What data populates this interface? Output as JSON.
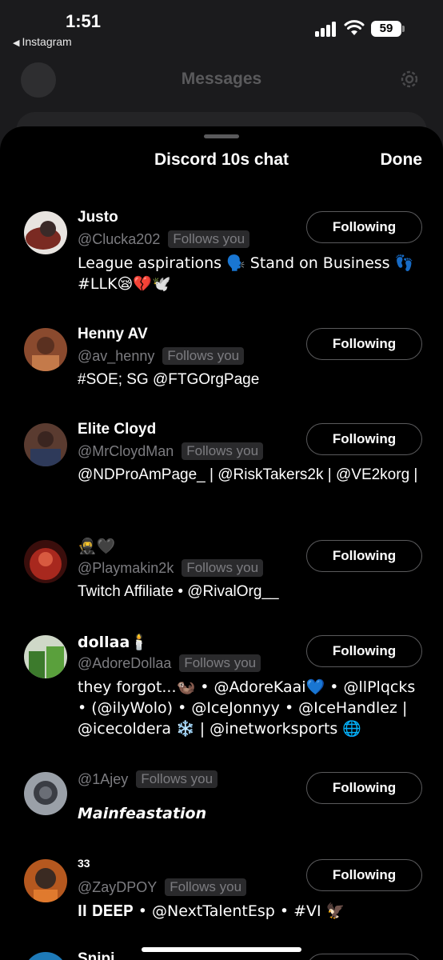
{
  "status_bar": {
    "time": "1:51",
    "back_app": "Instagram",
    "battery": "59"
  },
  "background": {
    "title": "Messages"
  },
  "sheet": {
    "title": "Discord 10s chat",
    "done_label": "Done"
  },
  "members": [
    {
      "name": "Justo",
      "handle": "@Clucka202",
      "follows_you": "Follows you",
      "bio": "League aspirations 🗣️ Stand on Business 👣 #LLK😪💔🕊️",
      "button": "Following",
      "avatar_color": "#6b2a24"
    },
    {
      "name": "Henny AV",
      "handle": "@av_henny",
      "follows_you": "Follows you",
      "bio": "#SOE; SG @FTGOrgPage",
      "button": "Following",
      "avatar_color": "#8a4a2e"
    },
    {
      "name": "Elite Cloyd",
      "handle": "@MrCloydMan",
      "follows_you": "Follows you",
      "bio": "@NDProAmPage_ | @RiskTakers2k | @VE2korg |",
      "button": "Following",
      "avatar_color": "#5a3b30"
    },
    {
      "name": "🥷🖤",
      "handle": "@Playmakin2k",
      "follows_you": "Follows you",
      "bio": "Twitch Affiliate • @RivalOrg__",
      "button": "Following",
      "avatar_color": "#7a1e1a"
    },
    {
      "name": "dollaa🕯️",
      "handle": "@AdoreDollaa",
      "follows_you": "Follows you",
      "bio": "they forgot...🦦 • @AdoreKaai💙 • @llPlqcks • (@ilyWolo) • @IceJonnyy • @IceHandlez | @icecoldera ❄️ | @inetworksports 🌐",
      "button": "Following",
      "avatar_color": "#4e7a3c"
    },
    {
      "name": "",
      "handle": "@1Ajey",
      "follows_you": "Follows you",
      "bio": "𝙈𝙖𝙞𝙣𝙛𝙚𝙖𝙨𝙩𝙖𝙩𝙞𝙤𝙣",
      "button": "Following",
      "avatar_color": "#3a3d44"
    },
    {
      "name": "33",
      "handle": "@ZayDPOY",
      "follows_you": "Follows you",
      "bio": "𝐈𝐈 𝐃𝐄𝐄𝐏 • @NextTalentEsp • #VI 🦅",
      "button": "Following",
      "avatar_color": "#b5581f"
    },
    {
      "name": "Snipi",
      "handle": "",
      "follows_you": "",
      "bio": "",
      "button": "",
      "avatar_color": "#1e7ab8"
    }
  ]
}
